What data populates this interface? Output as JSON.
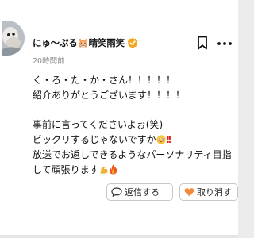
{
  "post": {
    "username": "にゅ〜ぷる🐹晴笑雨笑",
    "timestamp": "20時間前",
    "body_lines": [
      "く・ろ・た・か・さん！！！！！",
      "紹介ありがとうございます！！！！",
      "",
      "事前に言ってくださいよぉ(笑)",
      "ビックリするじゃないですか",
      "放送でお返しできるようなパーソナリティ目指",
      "して頑張ります"
    ]
  },
  "actions": {
    "reply_label": "返信する",
    "unlike_label": "取り消す"
  },
  "icons": {
    "verified": "verified-badge-icon",
    "bookmark": "bookmark-icon",
    "more": "more-options-icon",
    "reply": "reply-bubble-icon",
    "like": "heart-icon"
  },
  "colors": {
    "verified": "#f5a623",
    "heart": "#f08a3c",
    "muted_text": "#8a8a8a"
  }
}
